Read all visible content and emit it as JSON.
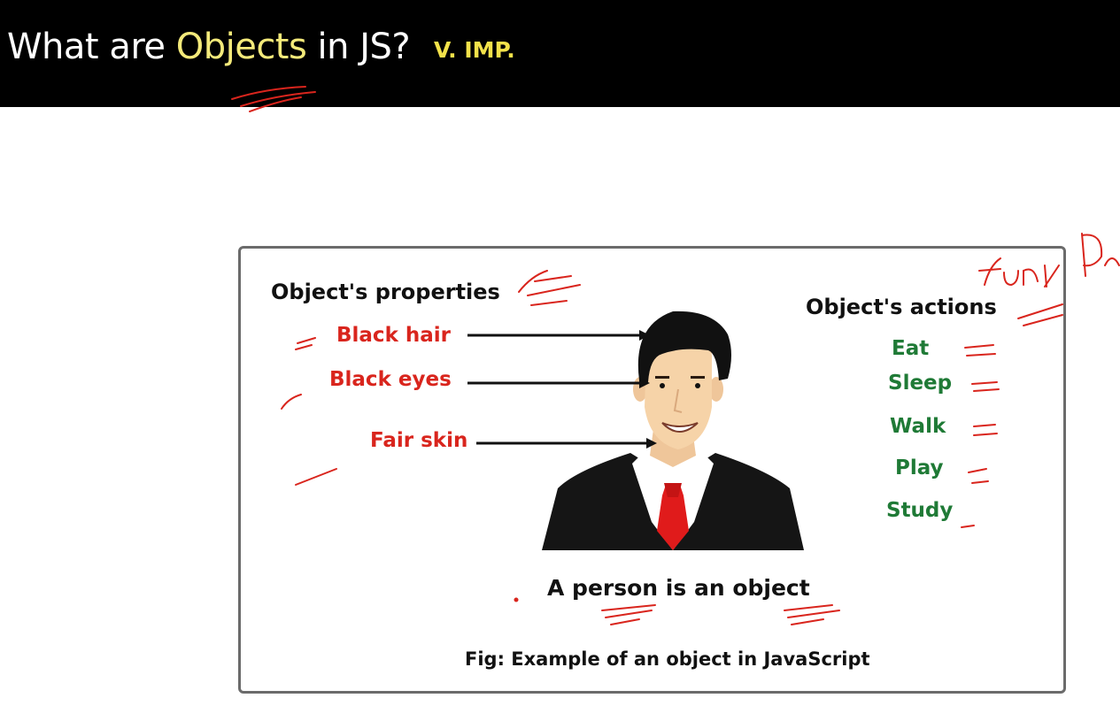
{
  "slide": {
    "title_prefix": "What are ",
    "title_highlight": "Objects",
    "title_suffix": " in JS?",
    "badge": "V. IMP."
  },
  "figure": {
    "properties_heading": "Object's properties",
    "properties": [
      "Black hair",
      "Black eyes",
      "Fair skin"
    ],
    "actions_heading": "Object's actions",
    "actions": [
      "Eat",
      "Sleep",
      "Walk",
      "Play",
      "Study"
    ],
    "person_caption": "A person is an object",
    "figure_caption": "Fig: Example of an object in JavaScript"
  },
  "annotations": {
    "handwritten_note": "func",
    "handwritten_note_cut": "Pa",
    "ink_color": "#d9251d"
  }
}
